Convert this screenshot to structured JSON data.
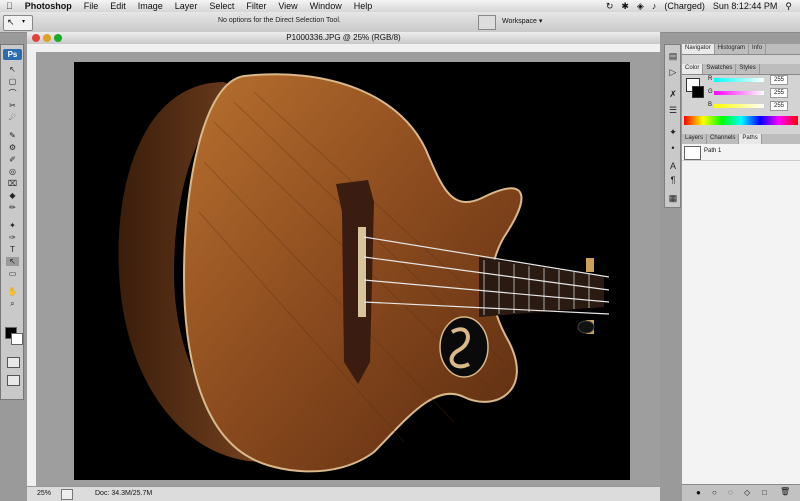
{
  "menubar": {
    "apple": "",
    "items": [
      "Photoshop",
      "File",
      "Edit",
      "Image",
      "Layer",
      "Select",
      "Filter",
      "View",
      "Window",
      "Help"
    ],
    "battery": "(Charged)",
    "clock": "Sun 8:12:44 PM"
  },
  "options_bar": {
    "message": "No options for the Direct Selection Tool.",
    "workspace": "Workspace ▾"
  },
  "tools": {
    "logo": "Ps",
    "icons": [
      "↖",
      "▢",
      "⌒",
      "✂",
      "☄",
      "✎",
      "⚙",
      "✐",
      "◎",
      "⌧",
      "◆",
      "✏",
      "✦",
      "✑",
      "T",
      "↖",
      "▭",
      "✋",
      "⌕",
      "■"
    ]
  },
  "document": {
    "title": "P1000336.JPG @ 25% (RGB/8)",
    "zoom": "25%",
    "doc_info": "Doc: 34.3M/25.7M"
  },
  "panels": {
    "top_tabs": [
      "Navigator",
      "Histogram",
      "Info"
    ],
    "color_tabs": [
      "Color",
      "Swatches",
      "Styles"
    ],
    "channels": [
      {
        "label": "R",
        "value": "255"
      },
      {
        "label": "G",
        "value": "255"
      },
      {
        "label": "B",
        "value": "255"
      }
    ],
    "layers_tabs": [
      "Layers",
      "Channels",
      "Paths"
    ],
    "path_name": "Path 1"
  },
  "colors": {
    "photo_bg": "#000000",
    "wood": "#8a4a1e"
  }
}
